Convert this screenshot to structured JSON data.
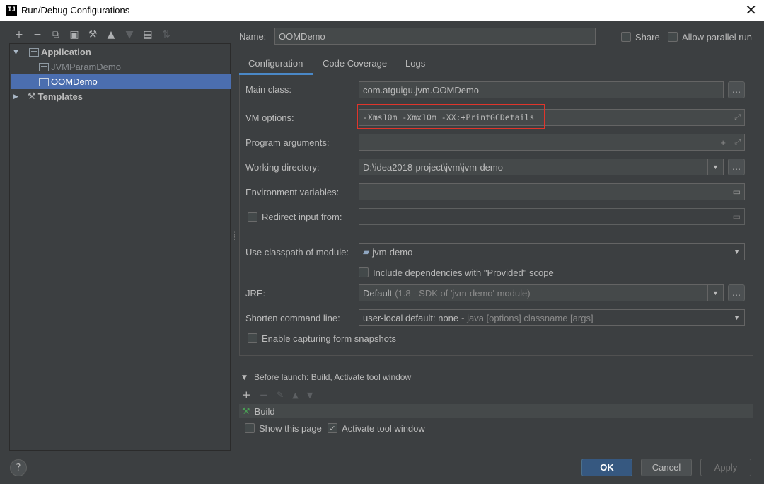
{
  "window": {
    "title": "Run/Debug Configurations",
    "logo_text": "IJ"
  },
  "toolbar": {
    "icons": [
      "add-icon",
      "remove-icon",
      "copy-icon",
      "save-icon",
      "wrench-icon",
      "move-up-icon",
      "move-down-icon",
      "new-folder-icon",
      "sort-icon"
    ]
  },
  "tree": {
    "application": "Application",
    "items": [
      "JVMParamDemo",
      "OOMDemo"
    ],
    "templates": "Templates"
  },
  "name_row": {
    "label": "Name:",
    "value": "OOMDemo",
    "share": "Share",
    "allow_parallel": "Allow parallel run"
  },
  "tabs": [
    "Configuration",
    "Code Coverage",
    "Logs"
  ],
  "form": {
    "main_class_label": "Main class:",
    "main_class_value": "com.atguigu.jvm.OOMDemo",
    "vm_options_label": "VM options:",
    "vm_options_value": "-Xms10m -Xmx10m -XX:+PrintGCDetails",
    "program_args_label": "Program arguments:",
    "program_args_value": "",
    "working_dir_label": "Working directory:",
    "working_dir_value": "D:\\idea2018-project\\jvm\\jvm-demo",
    "env_vars_label": "Environment variables:",
    "redirect_label": "Redirect input from:",
    "classpath_label": "Use classpath of module:",
    "classpath_value": "jvm-demo",
    "include_deps_label": "Include dependencies with \"Provided\" scope",
    "jre_label": "JRE:",
    "jre_value": "Default",
    "jre_hint": "(1.8 - SDK of 'jvm-demo' module)",
    "shorten_label": "Shorten command line:",
    "shorten_value": "user-local default: none",
    "shorten_hint": "- java [options] classname [args]",
    "snapshots_label": "Enable capturing form snapshots"
  },
  "before_launch": {
    "header": "Before launch: Build, Activate tool window",
    "task": "Build",
    "show_page": "Show this page",
    "activate_tool_window": "Activate tool window"
  },
  "buttons": {
    "ok": "OK",
    "cancel": "Cancel",
    "apply": "Apply",
    "help": "?"
  },
  "colors": {
    "background": "#3c3f41",
    "selection": "#4b6eaf",
    "highlight_box": "#e0352b",
    "ok_button": "#365880",
    "tab_underline": "#4a88c7"
  }
}
